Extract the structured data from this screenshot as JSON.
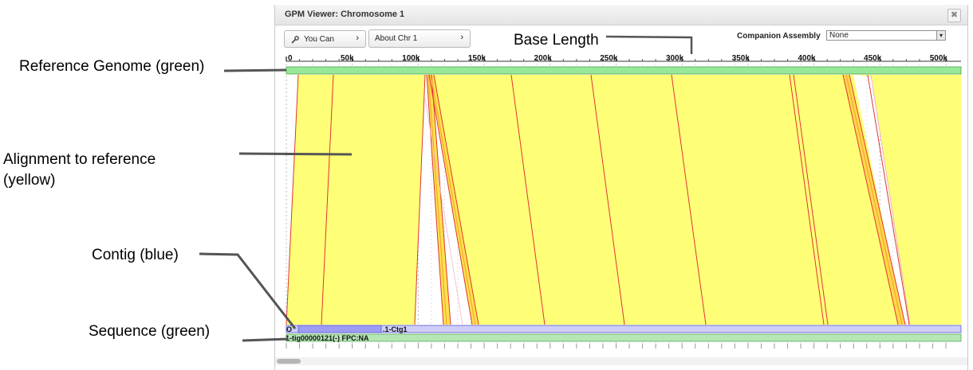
{
  "annotations": {
    "reference_genome": "Reference Genome (green)",
    "alignment_line1": "Alignment  to reference",
    "alignment_line2": "(yellow)",
    "contig": "Contig (blue)",
    "sequence": "Sequence (green)",
    "base_length": "Base Length"
  },
  "window": {
    "title": "GPM Viewer: Chromosome 1",
    "close_icon": "close-icon"
  },
  "toolbar": {
    "you_can_label": "You Can",
    "about_label": "About Chr 1",
    "companion_label": "Companion Assembly",
    "companion_value": "None"
  },
  "ruler": {
    "ticks": [
      "0",
      "50k",
      "100k",
      "150k",
      "200k",
      "250k",
      "300k",
      "350k",
      "400k",
      "450k",
      "500k"
    ]
  },
  "tracks": {
    "contig_label": ".1-Ctg1",
    "contig_prefix": "O",
    "sequence_label": "1-tig00000121(-) FPC:NA"
  },
  "colors": {
    "reference": "#99e899",
    "alignment": "#ffff77",
    "alignment_edge": "#e03030",
    "contig": "#9d9df5",
    "sequence": "#b6e6b6"
  }
}
